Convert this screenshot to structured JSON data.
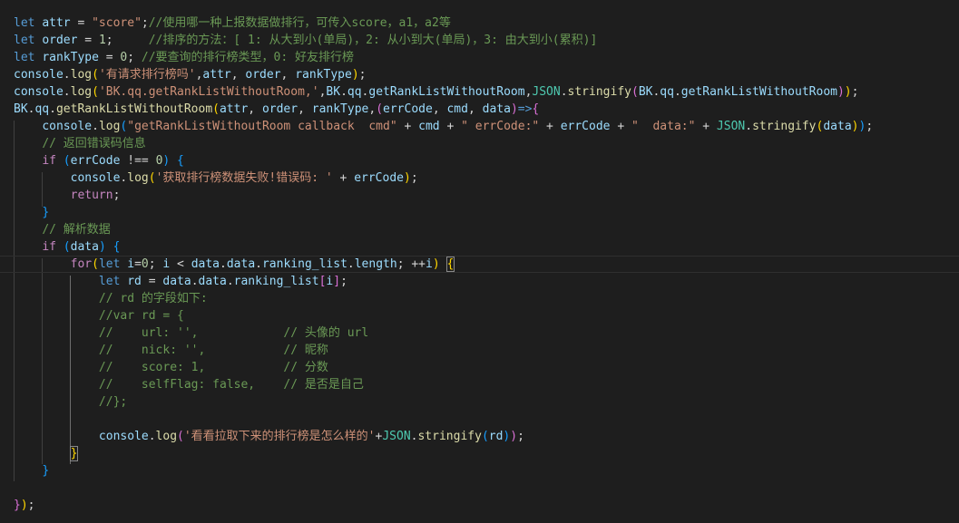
{
  "editor": {
    "lines": [
      [
        [
          "k",
          "let"
        ],
        [
          "o",
          " "
        ],
        [
          "v",
          "attr"
        ],
        [
          "o",
          " = "
        ],
        [
          "s",
          "\"score\""
        ],
        [
          "o",
          ";"
        ],
        [
          "m",
          "//使用哪一种上报数据做排行，可传入score，a1，a2等"
        ]
      ],
      [
        [
          "k",
          "let"
        ],
        [
          "o",
          " "
        ],
        [
          "v",
          "order"
        ],
        [
          "o",
          " = "
        ],
        [
          "n",
          "1"
        ],
        [
          "o",
          ";     "
        ],
        [
          "m",
          "//排序的方法：[ 1: 从大到小(单局)，2: 从小到大(单局)，3: 由大到小(累积)]"
        ]
      ],
      [
        [
          "k",
          "let"
        ],
        [
          "o",
          " "
        ],
        [
          "v",
          "rankType"
        ],
        [
          "o",
          " = "
        ],
        [
          "n",
          "0"
        ],
        [
          "o",
          "; "
        ],
        [
          "m",
          "//要查询的排行榜类型，0: 好友排行榜"
        ]
      ],
      [
        [
          "v",
          "console"
        ],
        [
          "o",
          "."
        ],
        [
          "f",
          "log"
        ],
        [
          "y",
          "("
        ],
        [
          "s",
          "'有请求排行榜吗'"
        ],
        [
          "o",
          ","
        ],
        [
          "v",
          "attr"
        ],
        [
          "o",
          ", "
        ],
        [
          "v",
          "order"
        ],
        [
          "o",
          ", "
        ],
        [
          "v",
          "rankType"
        ],
        [
          "y",
          ")"
        ],
        [
          "o",
          ";"
        ]
      ],
      [
        [
          "v",
          "console"
        ],
        [
          "o",
          "."
        ],
        [
          "f",
          "log"
        ],
        [
          "y",
          "("
        ],
        [
          "s",
          "'BK.qq.getRankListWithoutRoom,'"
        ],
        [
          "o",
          ","
        ],
        [
          "v",
          "BK"
        ],
        [
          "o",
          "."
        ],
        [
          "v",
          "qq"
        ],
        [
          "o",
          "."
        ],
        [
          "v",
          "getRankListWithoutRoom"
        ],
        [
          "o",
          ","
        ],
        [
          "t",
          "JSON"
        ],
        [
          "o",
          "."
        ],
        [
          "f",
          "stringify"
        ],
        [
          "p",
          "("
        ],
        [
          "v",
          "BK"
        ],
        [
          "o",
          "."
        ],
        [
          "v",
          "qq"
        ],
        [
          "o",
          "."
        ],
        [
          "v",
          "getRankListWithoutRoom"
        ],
        [
          "p",
          ")"
        ],
        [
          "y",
          ")"
        ],
        [
          "o",
          ";"
        ]
      ],
      [
        [
          "v",
          "BK"
        ],
        [
          "o",
          "."
        ],
        [
          "v",
          "qq"
        ],
        [
          "o",
          "."
        ],
        [
          "f",
          "getRankListWithoutRoom"
        ],
        [
          "y",
          "("
        ],
        [
          "v",
          "attr"
        ],
        [
          "o",
          ", "
        ],
        [
          "v",
          "order"
        ],
        [
          "o",
          ", "
        ],
        [
          "v",
          "rankType"
        ],
        [
          "o",
          ","
        ],
        [
          "p",
          "("
        ],
        [
          "v",
          "errCode"
        ],
        [
          "o",
          ", "
        ],
        [
          "v",
          "cmd"
        ],
        [
          "o",
          ", "
        ],
        [
          "v",
          "data"
        ],
        [
          "p",
          ")"
        ],
        [
          "k",
          "=>"
        ],
        [
          "p",
          "{"
        ]
      ],
      [
        [
          "o",
          "    "
        ],
        [
          "v",
          "console"
        ],
        [
          "o",
          "."
        ],
        [
          "f",
          "log"
        ],
        [
          "b",
          "("
        ],
        [
          "s",
          "\"getRankListWithoutRoom callback  cmd\""
        ],
        [
          "o",
          " + "
        ],
        [
          "v",
          "cmd"
        ],
        [
          "o",
          " + "
        ],
        [
          "s",
          "\" errCode:\""
        ],
        [
          "o",
          " + "
        ],
        [
          "v",
          "errCode"
        ],
        [
          "o",
          " + "
        ],
        [
          "s",
          "\"  data:\""
        ],
        [
          "o",
          " + "
        ],
        [
          "t",
          "JSON"
        ],
        [
          "o",
          "."
        ],
        [
          "f",
          "stringify"
        ],
        [
          "y",
          "("
        ],
        [
          "v",
          "data"
        ],
        [
          "y",
          ")"
        ],
        [
          "b",
          ")"
        ],
        [
          "o",
          ";"
        ]
      ],
      [
        [
          "o",
          "    "
        ],
        [
          "m",
          "// 返回错误码信息"
        ]
      ],
      [
        [
          "o",
          "    "
        ],
        [
          "c",
          "if"
        ],
        [
          "o",
          " "
        ],
        [
          "b",
          "("
        ],
        [
          "v",
          "errCode"
        ],
        [
          "o",
          " !== "
        ],
        [
          "n",
          "0"
        ],
        [
          "b",
          ")"
        ],
        [
          "o",
          " "
        ],
        [
          "b",
          "{"
        ]
      ],
      [
        [
          "o",
          "        "
        ],
        [
          "v",
          "console"
        ],
        [
          "o",
          "."
        ],
        [
          "f",
          "log"
        ],
        [
          "y",
          "("
        ],
        [
          "s",
          "'获取排行榜数据失败!错误码: '"
        ],
        [
          "o",
          " + "
        ],
        [
          "v",
          "errCode"
        ],
        [
          "y",
          ")"
        ],
        [
          "o",
          ";"
        ]
      ],
      [
        [
          "o",
          "        "
        ],
        [
          "c",
          "return"
        ],
        [
          "o",
          ";"
        ]
      ],
      [
        [
          "o",
          "    "
        ],
        [
          "b",
          "}"
        ]
      ],
      [
        [
          "o",
          "    "
        ],
        [
          "m",
          "// 解析数据"
        ]
      ],
      [
        [
          "o",
          "    "
        ],
        [
          "c",
          "if"
        ],
        [
          "o",
          " "
        ],
        [
          "b",
          "("
        ],
        [
          "v",
          "data"
        ],
        [
          "b",
          ")"
        ],
        [
          "o",
          " "
        ],
        [
          "b",
          "{"
        ]
      ],
      [
        [
          "o",
          "        "
        ],
        [
          "c",
          "for"
        ],
        [
          "y",
          "("
        ],
        [
          "k",
          "let"
        ],
        [
          "o",
          " "
        ],
        [
          "v",
          "i"
        ],
        [
          "o",
          "="
        ],
        [
          "n",
          "0"
        ],
        [
          "o",
          "; "
        ],
        [
          "v",
          "i"
        ],
        [
          "o",
          " < "
        ],
        [
          "v",
          "data"
        ],
        [
          "o",
          "."
        ],
        [
          "v",
          "data"
        ],
        [
          "o",
          "."
        ],
        [
          "v",
          "ranking_list"
        ],
        [
          "o",
          "."
        ],
        [
          "v",
          "length"
        ],
        [
          "o",
          "; ++"
        ],
        [
          "v",
          "i"
        ],
        [
          "y",
          ")"
        ],
        [
          "o",
          " "
        ],
        [
          "y",
          "{",
          "bm"
        ]
      ],
      [
        [
          "o",
          "            "
        ],
        [
          "k",
          "let"
        ],
        [
          "o",
          " "
        ],
        [
          "v",
          "rd"
        ],
        [
          "o",
          " = "
        ],
        [
          "v",
          "data"
        ],
        [
          "o",
          "."
        ],
        [
          "v",
          "data"
        ],
        [
          "o",
          "."
        ],
        [
          "v",
          "ranking_list"
        ],
        [
          "p",
          "["
        ],
        [
          "v",
          "i"
        ],
        [
          "p",
          "]"
        ],
        [
          "o",
          ";"
        ]
      ],
      [
        [
          "o",
          "            "
        ],
        [
          "m",
          "// rd 的字段如下:"
        ]
      ],
      [
        [
          "o",
          "            "
        ],
        [
          "m",
          "//var rd = {"
        ]
      ],
      [
        [
          "o",
          "            "
        ],
        [
          "m",
          "//    url: '',            // 头像的 url"
        ]
      ],
      [
        [
          "o",
          "            "
        ],
        [
          "m",
          "//    nick: '',           // 昵称"
        ]
      ],
      [
        [
          "o",
          "            "
        ],
        [
          "m",
          "//    score: 1,           // 分数"
        ]
      ],
      [
        [
          "o",
          "            "
        ],
        [
          "m",
          "//    selfFlag: false,    // 是否是自己"
        ]
      ],
      [
        [
          "o",
          "            "
        ],
        [
          "m",
          "//};"
        ]
      ],
      [],
      [
        [
          "o",
          "            "
        ],
        [
          "v",
          "console"
        ],
        [
          "o",
          "."
        ],
        [
          "f",
          "log"
        ],
        [
          "p",
          "("
        ],
        [
          "s",
          "'看看拉取下来的排行榜是怎么样的'"
        ],
        [
          "o",
          "+"
        ],
        [
          "t",
          "JSON"
        ],
        [
          "o",
          "."
        ],
        [
          "f",
          "stringify"
        ],
        [
          "b",
          "("
        ],
        [
          "v",
          "rd"
        ],
        [
          "b",
          ")"
        ],
        [
          "p",
          ")"
        ],
        [
          "o",
          ";"
        ]
      ],
      [
        [
          "o",
          "        "
        ],
        [
          "y",
          "}",
          "bm"
        ]
      ],
      [
        [
          "o",
          "    "
        ],
        [
          "b",
          "}"
        ]
      ],
      [],
      [
        [
          "p",
          "}"
        ],
        [
          "y",
          ")"
        ],
        [
          "o",
          ";"
        ]
      ]
    ]
  }
}
